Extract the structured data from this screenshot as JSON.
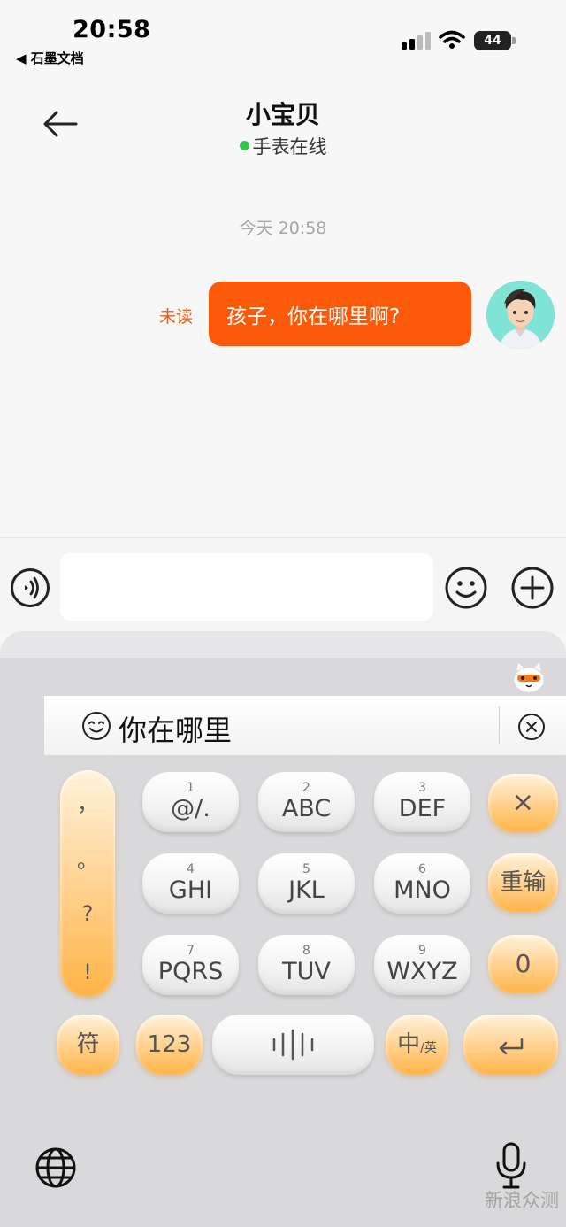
{
  "status_bar": {
    "time": "20:58",
    "back_app": "◀ 石墨文档",
    "battery": "44"
  },
  "header": {
    "title": "小宝贝",
    "status": "手表在线"
  },
  "chat": {
    "timestamp": "今天 20:58",
    "messages": [
      {
        "text": "孩子，你在哪里啊?",
        "read_status": "未读",
        "sender": "me"
      }
    ]
  },
  "input": {
    "value": "",
    "placeholder": ""
  },
  "keyboard": {
    "candidate": "你在哪里",
    "punct_keys": [
      "，",
      "。",
      "?",
      "!"
    ],
    "rows": [
      [
        {
          "num": "1",
          "letters": "@/."
        },
        {
          "num": "2",
          "letters": "ABC"
        },
        {
          "num": "3",
          "letters": "DEF"
        }
      ],
      [
        {
          "num": "4",
          "letters": "GHI"
        },
        {
          "num": "5",
          "letters": "JKL"
        },
        {
          "num": "6",
          "letters": "MNO"
        }
      ],
      [
        {
          "num": "7",
          "letters": "PQRS"
        },
        {
          "num": "8",
          "letters": "TUV"
        },
        {
          "num": "9",
          "letters": "WXYZ"
        }
      ]
    ],
    "right_keys": {
      "delete": "×",
      "retype": "重输",
      "zero": "0"
    },
    "bottom": {
      "symbols": "符",
      "numbers": "123",
      "lang_main": "中",
      "lang_sub": "/英"
    }
  },
  "watermark": "新浪众测",
  "colors": {
    "accent": "#fa5a0a",
    "online": "#2cc74b",
    "key_orange": "#ffb347"
  }
}
